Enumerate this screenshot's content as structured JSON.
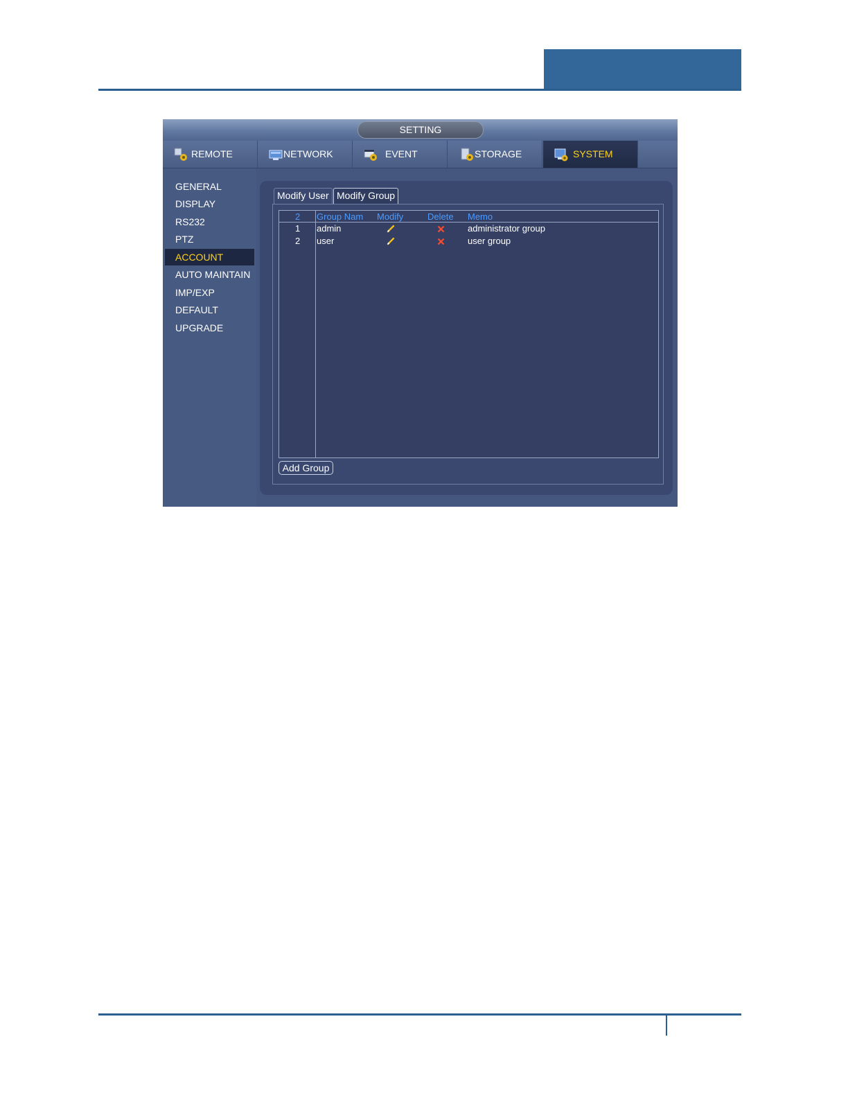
{
  "window": {
    "title": "SETTING"
  },
  "top_tabs": [
    {
      "label": "REMOTE",
      "icon": "remote-icon"
    },
    {
      "label": "NETWORK",
      "icon": "network-icon"
    },
    {
      "label": "EVENT",
      "icon": "event-icon"
    },
    {
      "label": "STORAGE",
      "icon": "storage-icon"
    },
    {
      "label": "SYSTEM",
      "icon": "system-icon",
      "active": true
    }
  ],
  "sidebar": {
    "items": [
      {
        "label": "GENERAL"
      },
      {
        "label": "DISPLAY"
      },
      {
        "label": "RS232"
      },
      {
        "label": "PTZ"
      },
      {
        "label": "ACCOUNT",
        "active": true
      },
      {
        "label": "AUTO MAINTAIN"
      },
      {
        "label": "IMP/EXP"
      },
      {
        "label": "DEFAULT"
      },
      {
        "label": "UPGRADE"
      }
    ]
  },
  "sub_tabs": [
    {
      "label": "Modify User"
    },
    {
      "label": "Modify Group",
      "active": true
    }
  ],
  "table": {
    "headers": {
      "count": "2",
      "name": "Group Nam",
      "modify": "Modify",
      "delete": "Delete",
      "memo": "Memo"
    },
    "rows": [
      {
        "index": "1",
        "name": "admin",
        "memo": "administrator group"
      },
      {
        "index": "2",
        "name": "user",
        "memo": "user group"
      }
    ]
  },
  "buttons": {
    "add_group": "Add Group"
  },
  "colors": {
    "accent": "#ffd21a",
    "header_text": "#4c9bff",
    "panel": "#3a4870",
    "brand": "#336699"
  }
}
